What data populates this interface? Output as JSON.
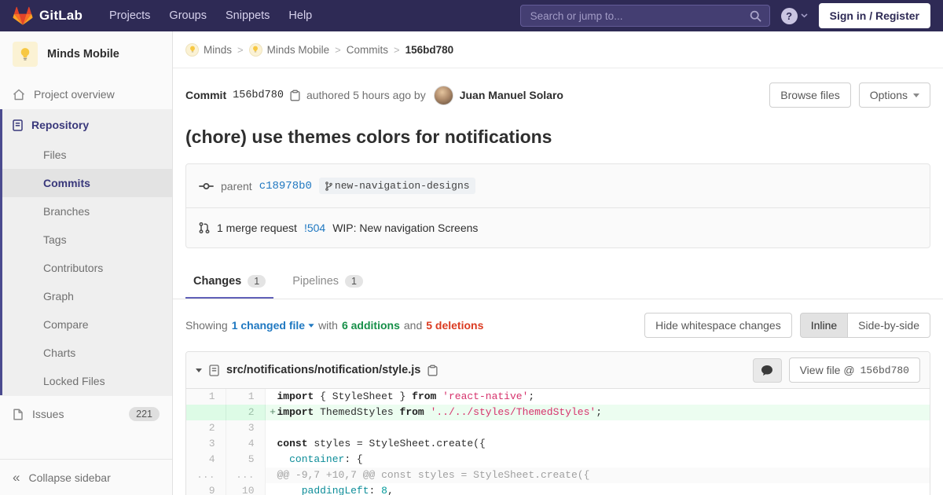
{
  "navbar": {
    "brand": "GitLab",
    "links": [
      "Projects",
      "Groups",
      "Snippets",
      "Help"
    ],
    "search_placeholder": "Search or jump to...",
    "help_glyph": "?",
    "sign_in": "Sign in / Register"
  },
  "sidebar": {
    "project_name": "Minds Mobile",
    "overview_label": "Project overview",
    "repository": {
      "label": "Repository",
      "items": [
        "Files",
        "Commits",
        "Branches",
        "Tags",
        "Contributors",
        "Graph",
        "Compare",
        "Charts",
        "Locked Files"
      ],
      "active_item": "Commits"
    },
    "issues_label": "Issues",
    "issues_count": "221",
    "collapse_label": "Collapse sidebar",
    "collapse_glyph": "«"
  },
  "breadcrumb": {
    "items": [
      {
        "label": "Minds",
        "avatar": true
      },
      {
        "label": "Minds Mobile",
        "avatar": true
      },
      {
        "label": "Commits",
        "avatar": false
      }
    ],
    "separator": ">",
    "current": "156bd780"
  },
  "commit": {
    "label": "Commit",
    "sha": "156bd780",
    "authored_text": "authored 5 hours ago by",
    "author": "Juan Manuel Solaro",
    "browse_files": "Browse files",
    "options": "Options",
    "title": "(chore) use themes colors for notifications",
    "parent_label": "parent",
    "parent_sha": "c18978b0",
    "branch": "new-navigation-designs",
    "mr_count_text": "1 merge request",
    "mr_id": "!504",
    "mr_title": "WIP: New navigation Screens"
  },
  "tabs": [
    {
      "label": "Changes",
      "count": "1",
      "active": true
    },
    {
      "label": "Pipelines",
      "count": "1",
      "active": false
    }
  ],
  "diff_meta": {
    "showing": "Showing",
    "changed_files": "1 changed file",
    "with": "with",
    "additions": "6 additions",
    "and": "and",
    "deletions": "5 deletions",
    "hide_whitespace": "Hide whitespace changes",
    "inline": "Inline",
    "side_by_side": "Side-by-side"
  },
  "file": {
    "path": "src/notifications/notification/style.js",
    "view_file_label": "View file @",
    "view_file_sha": "156bd780",
    "lines": [
      {
        "old": "1",
        "new": "1",
        "sign": " ",
        "type": "normal",
        "segs": [
          [
            "import",
            "k"
          ],
          [
            " { StyleSheet } ",
            "p"
          ],
          [
            "from",
            "k"
          ],
          [
            " ",
            "p"
          ],
          [
            "'react-native'",
            "s"
          ],
          [
            ";",
            "p"
          ]
        ]
      },
      {
        "old": "",
        "new": "2",
        "sign": "+",
        "type": "add",
        "segs": [
          [
            "import",
            "k"
          ],
          [
            " ThemedStyles ",
            "p"
          ],
          [
            "from",
            "k"
          ],
          [
            " ",
            "p"
          ],
          [
            "'../../styles/ThemedStyles'",
            "s"
          ],
          [
            ";",
            "p"
          ]
        ]
      },
      {
        "old": "2",
        "new": "3",
        "sign": " ",
        "type": "normal",
        "segs": []
      },
      {
        "old": "3",
        "new": "4",
        "sign": " ",
        "type": "normal",
        "segs": [
          [
            "const",
            "k"
          ],
          [
            " styles = StyleSheet.create({",
            "p"
          ]
        ]
      },
      {
        "old": "4",
        "new": "5",
        "sign": " ",
        "type": "normal",
        "segs": [
          [
            "  ",
            "p"
          ],
          [
            "container",
            "na"
          ],
          [
            ": {",
            "p"
          ]
        ]
      },
      {
        "old": "...",
        "new": "...",
        "sign": "",
        "type": "match",
        "segs": [
          [
            "@@ -9,7 +10,7 @@ const styles = StyleSheet.create({",
            "match-t"
          ]
        ]
      },
      {
        "old": "9",
        "new": "10",
        "sign": " ",
        "type": "normal",
        "segs": [
          [
            "    ",
            "p"
          ],
          [
            "paddingLeft",
            "na"
          ],
          [
            ": ",
            "p"
          ],
          [
            "8",
            "m"
          ],
          [
            ",",
            "p"
          ]
        ]
      }
    ]
  }
}
